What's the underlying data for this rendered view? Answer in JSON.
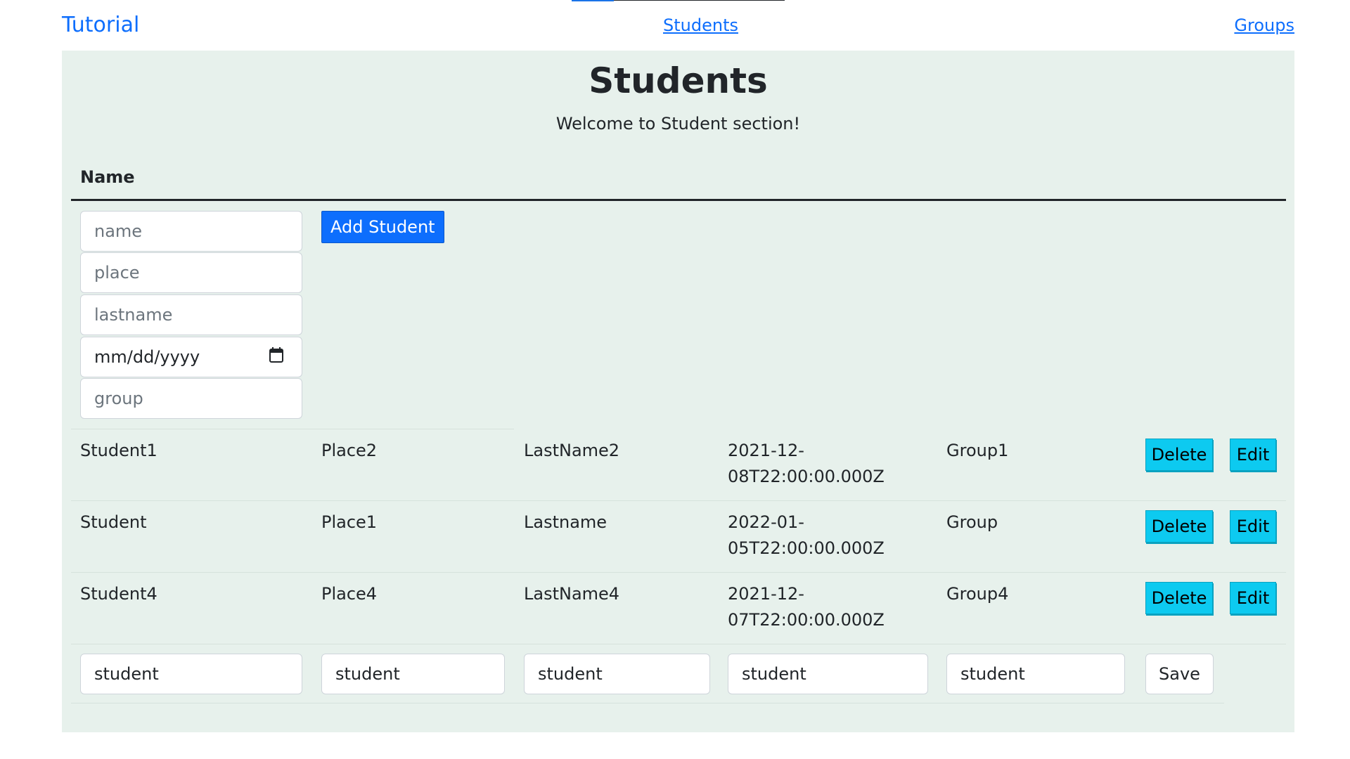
{
  "nav": {
    "brand": "Tutorial",
    "students_link": "Students",
    "groups_link": "Groups"
  },
  "header": {
    "title": "Students",
    "welcome": "Welcome to Student section!"
  },
  "table": {
    "header_name": "Name"
  },
  "form": {
    "name_placeholder": "name",
    "place_placeholder": "place",
    "lastname_placeholder": "lastname",
    "date_placeholder": "mm/dd/yyyy",
    "group_placeholder": "group",
    "add_label": "Add Student"
  },
  "rows": [
    {
      "name": "Student1",
      "place": "Place2",
      "lastname": "LastName2",
      "date_line1": "2021-12-",
      "date_line2": "08T22:00:00.000Z",
      "group": "Group1"
    },
    {
      "name": "Student",
      "place": "Place1",
      "lastname": "Lastname",
      "date_line1": "2022-01-",
      "date_line2": "05T22:00:00.000Z",
      "group": "Group"
    },
    {
      "name": "Student4",
      "place": "Place4",
      "lastname": "LastName4",
      "date_line1": "2021-12-",
      "date_line2": "07T22:00:00.000Z",
      "group": "Group4"
    }
  ],
  "row_actions": {
    "delete_label": "Delete",
    "edit_label": "Edit"
  },
  "edit_row": {
    "name_value": "student",
    "place_value": "student",
    "lastname_value": "student",
    "date_value": "student",
    "group_value": "student",
    "save_label": "Save"
  },
  "colors": {
    "panel_bg": "#e7f1ec",
    "primary": "#0d6efd",
    "info": "#0dcaf0"
  }
}
